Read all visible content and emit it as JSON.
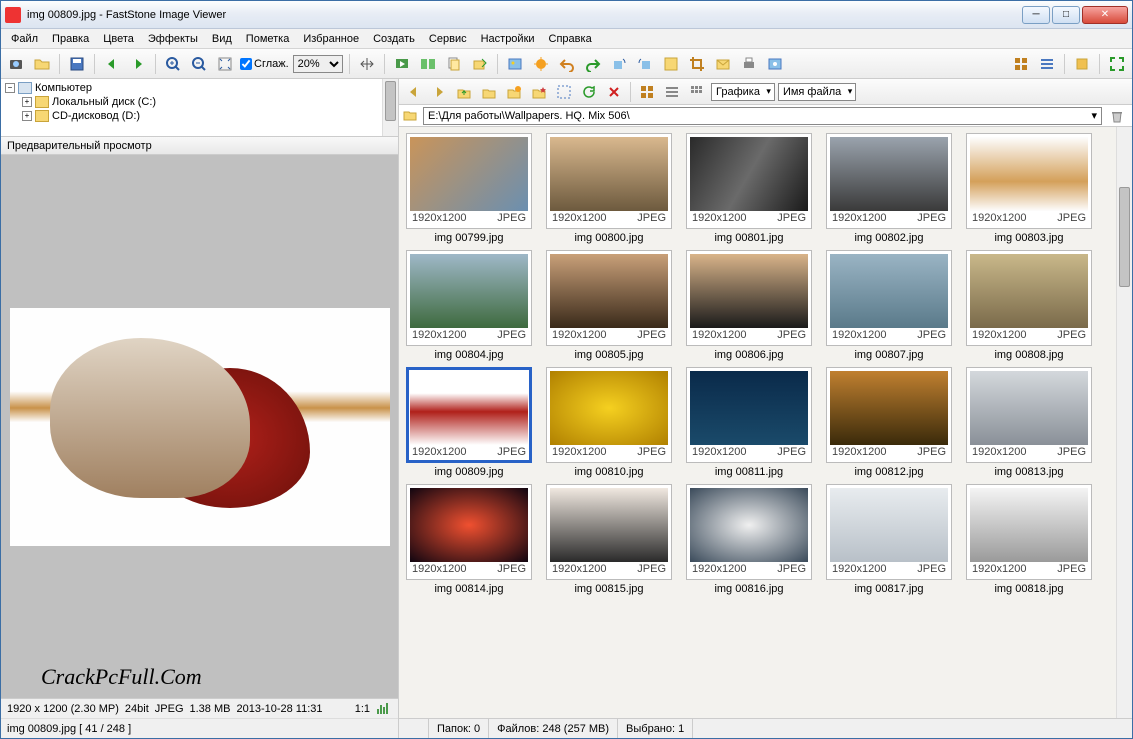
{
  "title": "img 00809.jpg  -  FastStone Image Viewer",
  "menu": [
    "Файл",
    "Правка",
    "Цвета",
    "Эффекты",
    "Вид",
    "Пометка",
    "Избранное",
    "Создать",
    "Сервис",
    "Настройки",
    "Справка"
  ],
  "toolbar": {
    "smooth_label": "Сглаж.",
    "zoom": "20%"
  },
  "tree": {
    "root": "Компьютер",
    "items": [
      "Локальный диск (C:)",
      "CD-дисковод (D:)"
    ]
  },
  "preview_header": "Предварительный просмотр",
  "watermark": "CrackPcFull.Com",
  "left_status": {
    "dims": "1920 x 1200 (2.30 MP)",
    "depth": "24bit",
    "fmt": "JPEG",
    "size": "1.38 MB",
    "date": "2013-10-28  11:31",
    "ratio": "1:1"
  },
  "left_footer": "img 00809.jpg   [ 41 / 248 ]",
  "browse": {
    "group_sel": "Графика",
    "sort_sel": "Имя файла"
  },
  "path": "E:\\Для работы\\Wallpapers. HQ. Mix 506\\",
  "thumbs": [
    {
      "res": "1920x1200",
      "fmt": "JPEG",
      "name": "img 00799.jpg",
      "bg": "linear-gradient(135deg,#c9945a,#6b8fb0)"
    },
    {
      "res": "1920x1200",
      "fmt": "JPEG",
      "name": "img 00800.jpg",
      "bg": "linear-gradient(#d9b88e,#6d5a3e)"
    },
    {
      "res": "1920x1200",
      "fmt": "JPEG",
      "name": "img 00801.jpg",
      "bg": "linear-gradient(120deg,#2a2a2a,#6a6a6a,#1a1a1a)"
    },
    {
      "res": "1920x1200",
      "fmt": "JPEG",
      "name": "img 00802.jpg",
      "bg": "linear-gradient(#9aa3ad,#3a3a3a)"
    },
    {
      "res": "1920x1200",
      "fmt": "JPEG",
      "name": "img 00803.jpg",
      "bg": "linear-gradient(#fdfdfd,#d4a05a 60%,#fdfdfd)"
    },
    {
      "res": "1920x1200",
      "fmt": "JPEG",
      "name": "img 00804.jpg",
      "bg": "linear-gradient(#9fb8c8,#3e6a3e)"
    },
    {
      "res": "1920x1200",
      "fmt": "JPEG",
      "name": "img 00805.jpg",
      "bg": "linear-gradient(#c9a079,#3a2a1a)"
    },
    {
      "res": "1920x1200",
      "fmt": "JPEG",
      "name": "img 00806.jpg",
      "bg": "linear-gradient(#d9b48a,#1a1a1a)"
    },
    {
      "res": "1920x1200",
      "fmt": "JPEG",
      "name": "img 00807.jpg",
      "bg": "linear-gradient(#9ab4c4,#5a7a8a)"
    },
    {
      "res": "1920x1200",
      "fmt": "JPEG",
      "name": "img 00808.jpg",
      "bg": "linear-gradient(#c9b88a,#7a6a4a)"
    },
    {
      "res": "1920x1200",
      "fmt": "JPEG",
      "name": "img 00809.jpg",
      "bg": "linear-gradient(#ffffff 30%,#b0201a 55%,#ffffff)",
      "selected": true
    },
    {
      "res": "1920x1200",
      "fmt": "JPEG",
      "name": "img 00810.jpg",
      "bg": "radial-gradient(#f5d020,#b08000)"
    },
    {
      "res": "1920x1200",
      "fmt": "JPEG",
      "name": "img 00811.jpg",
      "bg": "linear-gradient(#0a2a4a,#1a4a6a)"
    },
    {
      "res": "1920x1200",
      "fmt": "JPEG",
      "name": "img 00812.jpg",
      "bg": "linear-gradient(#c08030,#3a2a0a)"
    },
    {
      "res": "1920x1200",
      "fmt": "JPEG",
      "name": "img 00813.jpg",
      "bg": "linear-gradient(#d4d8dc,#8a9098)"
    },
    {
      "res": "1920x1200",
      "fmt": "JPEG",
      "name": "img 00814.jpg",
      "bg": "radial-gradient(#f05030,#100510)"
    },
    {
      "res": "1920x1200",
      "fmt": "JPEG",
      "name": "img 00815.jpg",
      "bg": "linear-gradient(#f0e8e0,#2a2a2a)"
    },
    {
      "res": "1920x1200",
      "fmt": "JPEG",
      "name": "img 00816.jpg",
      "bg": "radial-gradient(#f0f0f0,#3a4a5a)"
    },
    {
      "res": "1920x1200",
      "fmt": "JPEG",
      "name": "img 00817.jpg",
      "bg": "linear-gradient(#e8ecef,#b8c0c8)"
    },
    {
      "res": "1920x1200",
      "fmt": "JPEG",
      "name": "img 00818.jpg",
      "bg": "linear-gradient(#f4f4f4,#9a9a9a)"
    }
  ],
  "right_status": {
    "folders": "Папок: 0",
    "files": "Файлов: 248 (257 MB)",
    "selected": "Выбрано: 1"
  }
}
